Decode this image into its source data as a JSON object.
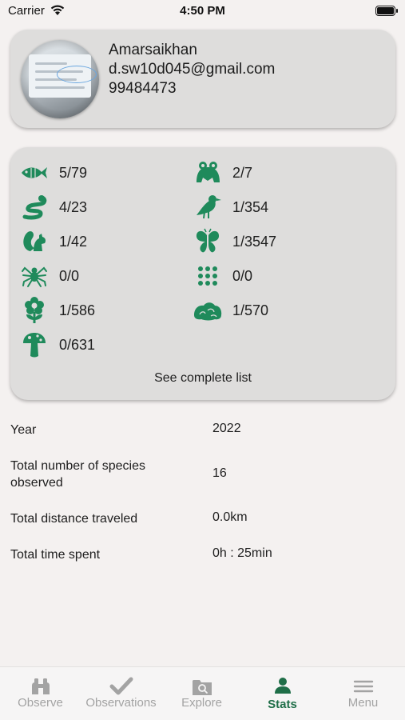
{
  "status_bar": {
    "carrier": "Carrier",
    "time": "4:50 PM"
  },
  "profile": {
    "name": "Amarsaikhan",
    "email": "d.sw10d045@gmail.com",
    "phone": "99484473"
  },
  "accent_color": "#1f8a5b",
  "species": [
    {
      "icon": "fish-icon",
      "count": "5/79"
    },
    {
      "icon": "frog-icon",
      "count": "2/7"
    },
    {
      "icon": "snake-icon",
      "count": "4/23"
    },
    {
      "icon": "bird-icon",
      "count": "1/354"
    },
    {
      "icon": "squirrel-icon",
      "count": "1/42"
    },
    {
      "icon": "butterfly-icon",
      "count": "1/3547"
    },
    {
      "icon": "spider-icon",
      "count": "0/0"
    },
    {
      "icon": "dots-grid-icon",
      "count": "0/0"
    },
    {
      "icon": "flower-icon",
      "count": "1/586"
    },
    {
      "icon": "moss-icon",
      "count": "1/570"
    },
    {
      "icon": "mushroom-icon",
      "count": "0/631"
    }
  ],
  "see_complete_list": "See complete list",
  "stats": [
    {
      "label": "Year",
      "value": "2022"
    },
    {
      "label": "Total number of species observed",
      "value": "16"
    },
    {
      "label": "Total distance traveled",
      "value": "0.0km"
    },
    {
      "label": "Total time spent",
      "value": "0h : 25min"
    }
  ],
  "tabs": [
    {
      "label": "Observe",
      "icon": "binoculars-icon"
    },
    {
      "label": "Observations",
      "icon": "checkmark-icon"
    },
    {
      "label": "Explore",
      "icon": "folder-search-icon"
    },
    {
      "label": "Stats",
      "icon": "person-icon",
      "active": true
    },
    {
      "label": "Menu",
      "icon": "hamburger-icon"
    }
  ]
}
